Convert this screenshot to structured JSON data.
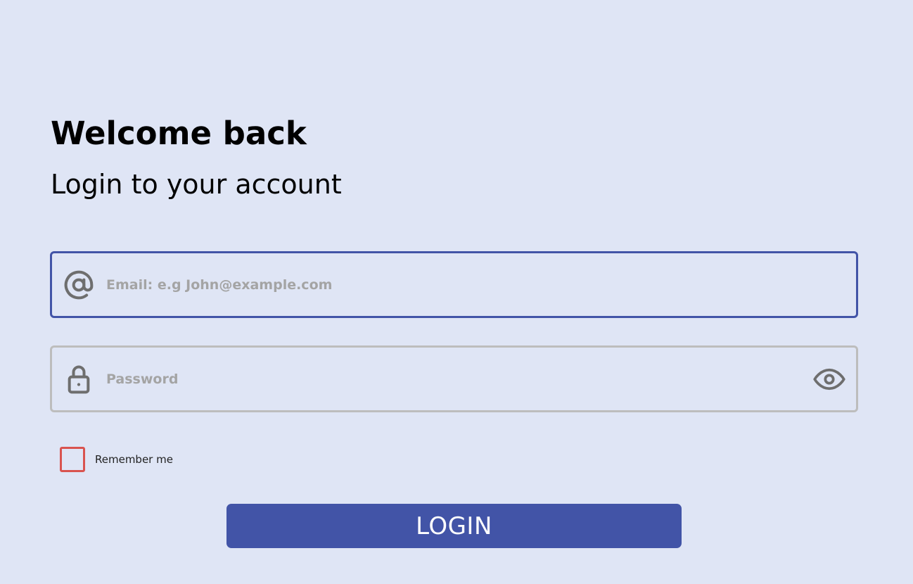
{
  "header": {
    "title": "Welcome back",
    "subtitle": "Login to your account"
  },
  "email_field": {
    "icon": "at-sign-icon",
    "value": "",
    "placeholder": "Email: e.g John@example.com",
    "border_color": "#4254a7"
  },
  "password_field": {
    "icon": "lock-icon",
    "value": "",
    "placeholder": "Password",
    "toggle_icon": "eye-icon",
    "border_color": "#bdbdbd"
  },
  "remember": {
    "label": "Remember me",
    "checked": false,
    "color": "#d9534f"
  },
  "login_button": {
    "label": "LOGIN",
    "color": "#4254a7"
  },
  "colors": {
    "background": "#dfe5f5",
    "icon": "#6e6e6e",
    "placeholder": "#a4a4a4"
  }
}
